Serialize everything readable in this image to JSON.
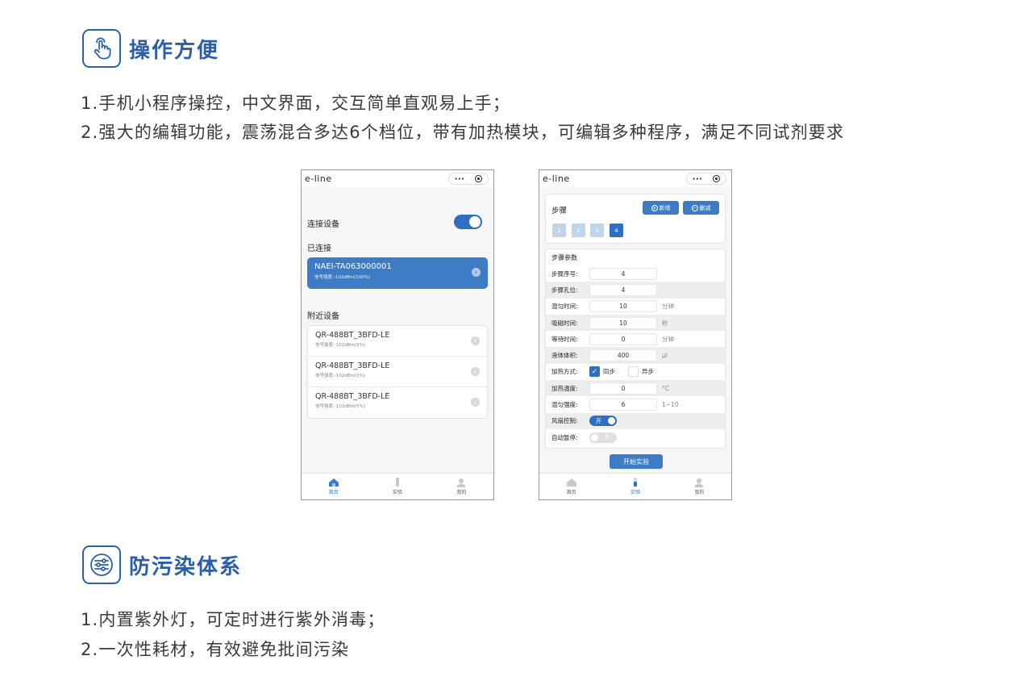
{
  "section1": {
    "title": "操作方便",
    "lines": [
      "1.手机小程序操控，中文界面，交互简单直观易上手；",
      "2.强大的编辑功能，震荡混合多达6个档位，带有加热模块，可编辑多种程序，满足不同试剂要求"
    ]
  },
  "section2": {
    "title": "防污染体系",
    "lines": [
      "1.内置紫外灯，可定时进行紫外消毒；",
      "2.一次性耗材，有效避免批间污染"
    ]
  },
  "phone_common": {
    "app_name": "e-line",
    "capsule_dots": "•••",
    "tabs": [
      "首页",
      "实验",
      "我的"
    ]
  },
  "phone1": {
    "connect_label": "连接设备",
    "connected_header": "已连接",
    "connected_device": {
      "name": "NAEI-TA063000001",
      "signal": "信号强度:-102dBm(100%)"
    },
    "nearby_header": "附近设备",
    "nearby_devices": [
      {
        "name": "QR-488BT_3BFD-LE",
        "signal": "信号强度:-102dBm(5%)"
      },
      {
        "name": "QR-488BT_3BFD-LE",
        "signal": "信号强度:-102dBm(5%)"
      },
      {
        "name": "QR-488BT_3BFD-LE",
        "signal": "信号强度:-102dBm(5%)"
      }
    ],
    "connect_toggle_on": true
  },
  "phone2": {
    "steps_title": "步骤",
    "add_label": "新增",
    "delete_label": "删减",
    "steps": [
      "1",
      "2",
      "3",
      "4"
    ],
    "active_step": "4",
    "params_title": "步骤参数",
    "params": {
      "step_no": {
        "label": "步骤序号:",
        "value": "4"
      },
      "step_well": {
        "label": "步骤孔位:",
        "value": "4"
      },
      "mix_time": {
        "label": "混匀时间:",
        "value": "10",
        "unit": "分钟"
      },
      "mag_time": {
        "label": "吸磁时间:",
        "value": "10",
        "unit": "秒"
      },
      "wait_time": {
        "label": "等待时间:",
        "value": "0",
        "unit": "分钟"
      },
      "volume": {
        "label": "液体体积:",
        "value": "400",
        "unit": "µl"
      },
      "heat_mode": {
        "label": "加热方式:",
        "opt_sync": "同步",
        "opt_async": "异步"
      },
      "heat_temp": {
        "label": "加热温度:",
        "value": "0",
        "unit": "°C"
      },
      "mix_strength": {
        "label": "混匀强度:",
        "value": "6",
        "unit": "1~10"
      },
      "fan": {
        "label": "风扇控制:",
        "state": "开"
      },
      "auto_pause": {
        "label": "自动暂停:",
        "state": "关"
      }
    },
    "start_label": "开始实验"
  },
  "colors": {
    "accent": "#2f6fc0",
    "title": "#2a5fa8"
  }
}
